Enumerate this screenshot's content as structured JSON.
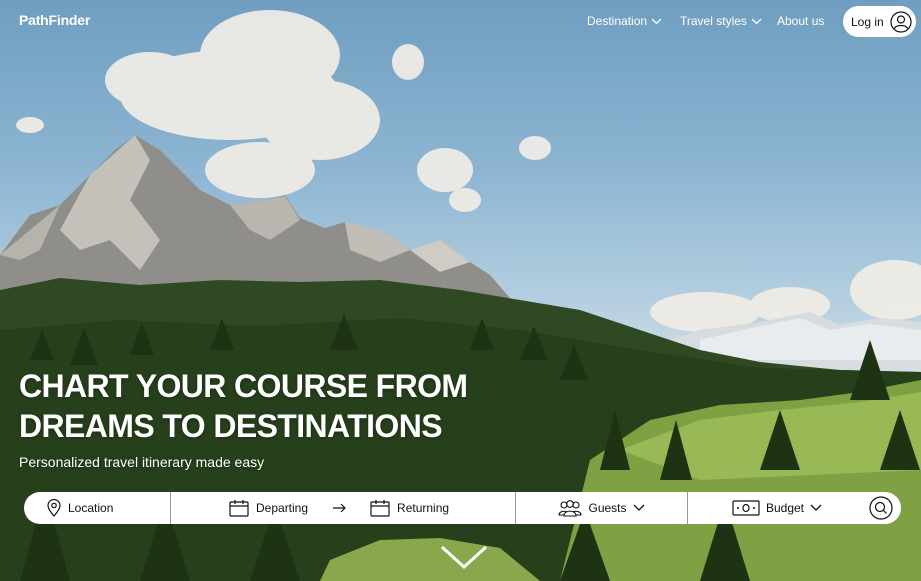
{
  "brand": {
    "name": "PathFinder"
  },
  "nav": {
    "items": [
      {
        "label": "Destination",
        "has_dropdown": true
      },
      {
        "label": "Travel styles",
        "has_dropdown": true
      },
      {
        "label": "About us",
        "has_dropdown": false
      }
    ],
    "login_label": "Log in"
  },
  "hero": {
    "headline_line1": "CHART YOUR COURSE FROM",
    "headline_line2": "DREAMS TO DESTINATIONS",
    "subheadline": "Personalized travel itinerary made easy"
  },
  "search": {
    "location_label": "Location",
    "departing_label": "Departing",
    "returning_label": "Returning",
    "guests_label": "Guests",
    "budget_label": "Budget"
  },
  "icons": {
    "location": "map-pin-icon",
    "calendar": "calendar-icon",
    "guests": "users-icon",
    "budget": "banknote-icon",
    "search": "search-icon",
    "chevron": "chevron-down-icon",
    "user": "user-circle-icon"
  },
  "colors": {
    "text_on_image": "#ffffff",
    "searchbar_bg": "#ffffff",
    "searchbar_text": "#111111"
  }
}
